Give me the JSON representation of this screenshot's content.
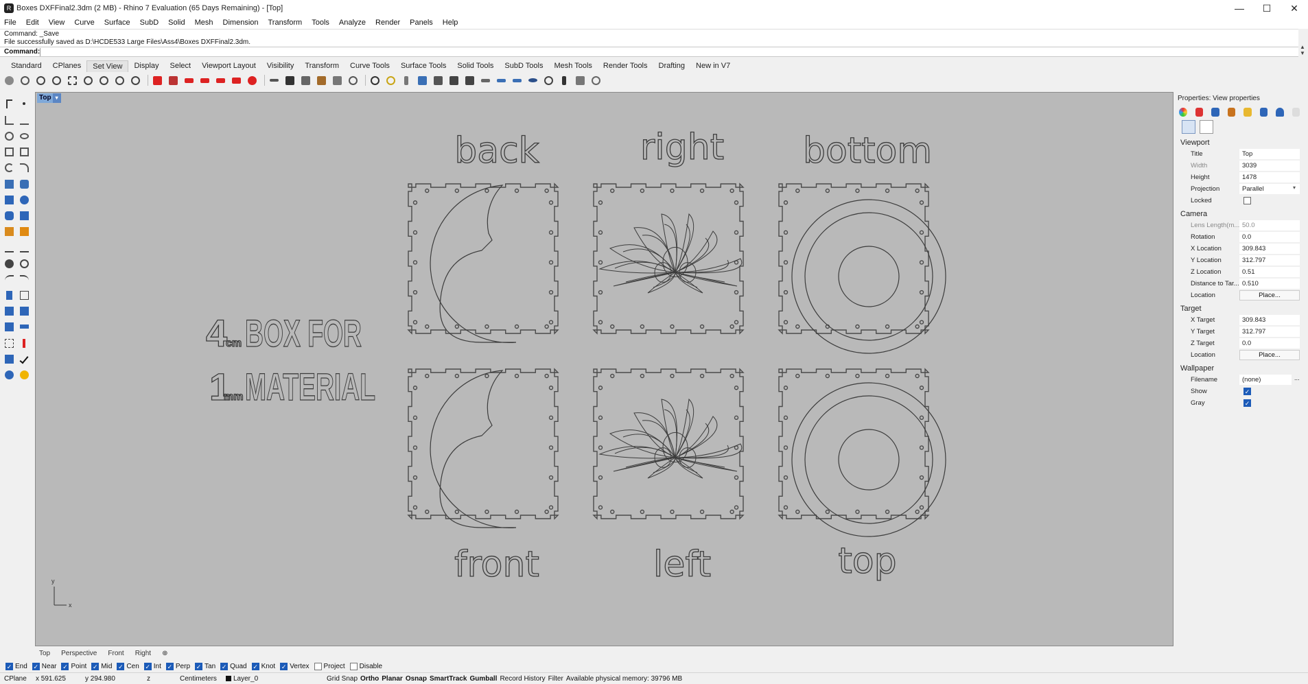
{
  "window": {
    "title": "Boxes DXFFinal2.3dm (2 MB) - Rhino 7 Evaluation (65 Days Remaining) - [Top]",
    "minimize": "—",
    "maximize": "☐",
    "close": "✕"
  },
  "menu": [
    "File",
    "Edit",
    "View",
    "Curve",
    "Surface",
    "SubD",
    "Solid",
    "Mesh",
    "Dimension",
    "Transform",
    "Tools",
    "Analyze",
    "Render",
    "Panels",
    "Help"
  ],
  "command_history": {
    "line1": "Command: _Save",
    "line2": "File successfully saved as D:\\HCDE533 Large Files\\Ass4\\Boxes DXFFinal2.3dm."
  },
  "command_prompt": {
    "label": "Command:",
    "value": ""
  },
  "toolbar_tabs": [
    "Standard",
    "CPlanes",
    "Set View",
    "Display",
    "Select",
    "Viewport Layout",
    "Visibility",
    "Transform",
    "Curve Tools",
    "Surface Tools",
    "Solid Tools",
    "SubD Tools",
    "Mesh Tools",
    "Render Tools",
    "Drafting",
    "New in V7"
  ],
  "active_toolbar_tab": "Set View",
  "toolbar_icons": [
    "pan-icon",
    "rotate-view-icon",
    "zoom-icon",
    "zoom-extents-icon",
    "zoom-window-icon",
    "zoom-selected-icon",
    "undo-view-icon",
    "zoom-in-icon",
    "zoom-out-icon",
    "front-view-icon",
    "back-view-icon",
    "left-view-icon",
    "right-view-icon",
    "top-view-icon",
    "bottom-view-icon",
    "perspective-icon",
    "named-views-icon",
    "camera-icon",
    "plan-icon",
    "elevation-icon",
    "background-icon",
    "set-cplane-icon",
    "target-icon",
    "camera-lens-icon",
    "walk-icon",
    "display-modes-icon",
    "snapshot-icon",
    "cube-icon",
    "frame-icon",
    "sun-icon",
    "light-icon",
    "spot-icon",
    "disk-icon",
    "rotate-icon",
    "walkabout-icon",
    "star-icon",
    "globe-icon"
  ],
  "viewport": {
    "label": "Top",
    "labels_top": [
      "back",
      "right",
      "bottom"
    ],
    "labels_bottom": [
      "front",
      "left",
      "top"
    ],
    "side_text_line1": "4",
    "side_text_unit1": "cm",
    "side_text_rest1": "BOX FOR",
    "side_text_line2": "1",
    "side_text_unit2": "mm",
    "side_text_rest2": "MATERIAL",
    "axis_y": "y",
    "axis_x": "x"
  },
  "viewport_tabs": [
    "Top",
    "Perspective",
    "Front",
    "Right",
    "⊕"
  ],
  "properties": {
    "header": "Properties: View properties",
    "viewport_section": "Viewport",
    "rows_viewport": [
      {
        "label": "Title",
        "value": "Top",
        "dim": false
      },
      {
        "label": "Width",
        "value": "3039",
        "dim": true
      },
      {
        "label": "Height",
        "value": "1478",
        "dim": false
      },
      {
        "label": "Projection",
        "value": "Parallel",
        "dim": false
      },
      {
        "label": "Locked",
        "value": "",
        "dim": false
      }
    ],
    "camera_section": "Camera",
    "rows_camera": [
      {
        "label": "Lens Length(m...",
        "value": "50.0",
        "dim": true
      },
      {
        "label": "Rotation",
        "value": "0.0",
        "dim": false
      },
      {
        "label": "X Location",
        "value": "309.843",
        "dim": false
      },
      {
        "label": "Y Location",
        "value": "312.797",
        "dim": false
      },
      {
        "label": "Z Location",
        "value": "0.51",
        "dim": false
      },
      {
        "label": "Distance to Tar...",
        "value": "0.510",
        "dim": false
      },
      {
        "label": "Location",
        "value": "Place...",
        "dim": false
      }
    ],
    "target_section": "Target",
    "rows_target": [
      {
        "label": "X Target",
        "value": "309.843"
      },
      {
        "label": "Y Target",
        "value": "312.797"
      },
      {
        "label": "Z Target",
        "value": "0.0"
      },
      {
        "label": "Location",
        "value": "Place..."
      }
    ],
    "wallpaper_section": "Wallpaper",
    "rows_wallpaper": [
      {
        "label": "Filename",
        "value": "(none)"
      },
      {
        "label": "Show",
        "value": "checked"
      },
      {
        "label": "Gray",
        "value": "checked"
      }
    ],
    "browse": "..."
  },
  "osnaps": [
    {
      "label": "End",
      "on": true
    },
    {
      "label": "Near",
      "on": true
    },
    {
      "label": "Point",
      "on": true
    },
    {
      "label": "Mid",
      "on": true
    },
    {
      "label": "Cen",
      "on": true
    },
    {
      "label": "Int",
      "on": true
    },
    {
      "label": "Perp",
      "on": true
    },
    {
      "label": "Tan",
      "on": true
    },
    {
      "label": "Quad",
      "on": true
    },
    {
      "label": "Knot",
      "on": true
    },
    {
      "label": "Vertex",
      "on": true
    },
    {
      "label": "Project",
      "on": false
    },
    {
      "label": "Disable",
      "on": false
    }
  ],
  "status": {
    "cplane": "CPlane",
    "x": "x 591.625",
    "y": "y 294.980",
    "z": "z",
    "units": "Centimeters",
    "layer": "Layer_0",
    "grid_snap": "Grid Snap",
    "ortho": "Ortho",
    "planar": "Planar",
    "osnap": "Osnap",
    "smarttrack": "SmartTrack",
    "gumball": "Gumball",
    "record_history": "Record History",
    "filter": "Filter",
    "memory": "Available physical memory: 39796 MB"
  }
}
